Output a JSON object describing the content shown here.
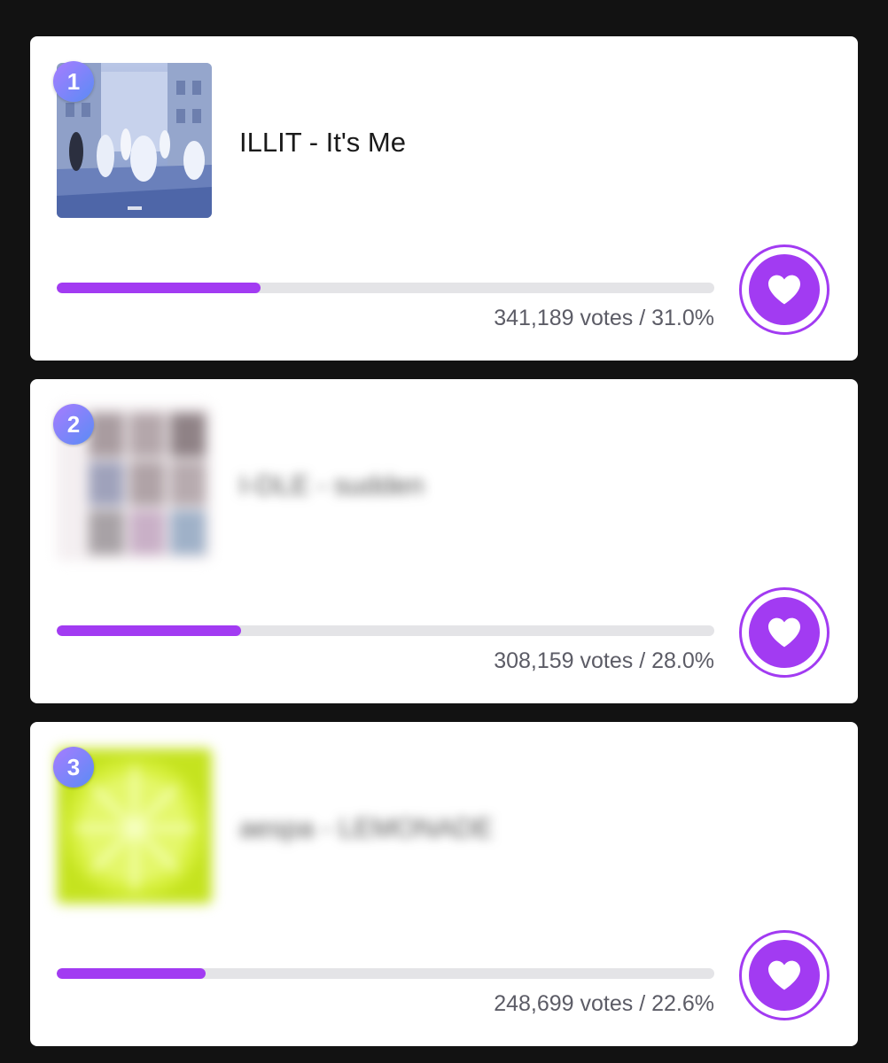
{
  "accent_color": "#a23bf2",
  "rank_gradient": [
    "#a77cff",
    "#5a8cf5"
  ],
  "entries": [
    {
      "rank": "1",
      "title": "ILLIT - It's Me",
      "title_blurred": false,
      "thumbnail": "album-cover-street-dancers",
      "votes_text": "341,189 votes",
      "separator": " / ",
      "percent_text": "31.0%",
      "progress_fraction": 0.31,
      "heart_icon": "heart-icon"
    },
    {
      "rank": "2",
      "title": "I-DLE - sudden",
      "title_blurred": true,
      "thumbnail": "album-cover-photo-grid",
      "votes_text": "308,159 votes",
      "separator": " / ",
      "percent_text": "28.0%",
      "progress_fraction": 0.28,
      "heart_icon": "heart-icon"
    },
    {
      "rank": "3",
      "title": "aespa - LEMONADE",
      "title_blurred": true,
      "thumbnail": "album-cover-lemon-slice",
      "votes_text": "248,699 votes",
      "separator": " / ",
      "percent_text": "22.6%",
      "progress_fraction": 0.226,
      "heart_icon": "heart-icon"
    }
  ]
}
